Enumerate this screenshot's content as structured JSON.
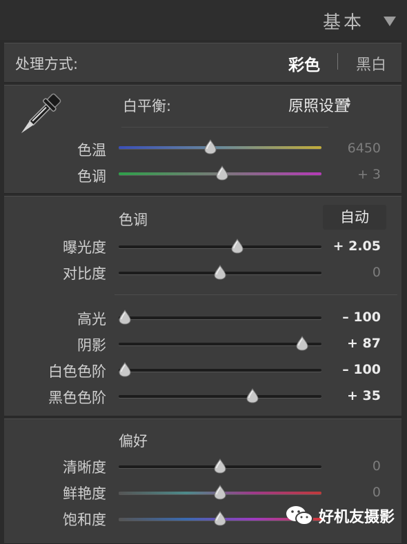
{
  "header": {
    "title": "基本"
  },
  "treatment": {
    "label": "处理方式:",
    "color": "彩色",
    "bw": "黑白"
  },
  "white_balance": {
    "label": "白平衡:",
    "preset": "原照设置",
    "temp": {
      "label": "色温",
      "value": "6450",
      "level": 0.45
    },
    "tint": {
      "label": "色调",
      "value": "+ 3",
      "level": 0.51
    }
  },
  "tone": {
    "title": "色调",
    "auto_label": "自动",
    "exposure": {
      "label": "曝光度",
      "value": "+ 2.05",
      "level": 0.59
    },
    "contrast": {
      "label": "对比度",
      "value": "0",
      "level": 0.5
    },
    "highlights": {
      "label": "高光",
      "value": "– 100",
      "level": 0.0
    },
    "shadows": {
      "label": "阴影",
      "value": "+ 87",
      "level": 0.93
    },
    "whites": {
      "label": "白色色阶",
      "value": "– 100",
      "level": 0.0
    },
    "blacks": {
      "label": "黑色色阶",
      "value": "+ 35",
      "level": 0.67
    }
  },
  "presence": {
    "title": "偏好",
    "clarity": {
      "label": "清晰度",
      "value": "0",
      "level": 0.5
    },
    "vibrance": {
      "label": "鲜艳度",
      "value": "0",
      "level": 0.5
    },
    "saturation": {
      "label": "饱和度",
      "level": 0.5
    }
  },
  "watermark": {
    "text": "好机友摄影"
  },
  "colors": {
    "temp_gradient": [
      "#3a4fb8",
      "#6a8a9a",
      "#c2ac3a"
    ],
    "tint_gradient": [
      "#2fa04a",
      "#7a7a7a",
      "#b63ab8"
    ],
    "vibrance_gradient": [
      "#555555",
      "#4d8a8a",
      "#9e3a8a",
      "#c03a3a"
    ],
    "saturation_gradient": [
      "#555555",
      "#3a6ab0",
      "#9e3ac0",
      "#d03a3a"
    ]
  }
}
